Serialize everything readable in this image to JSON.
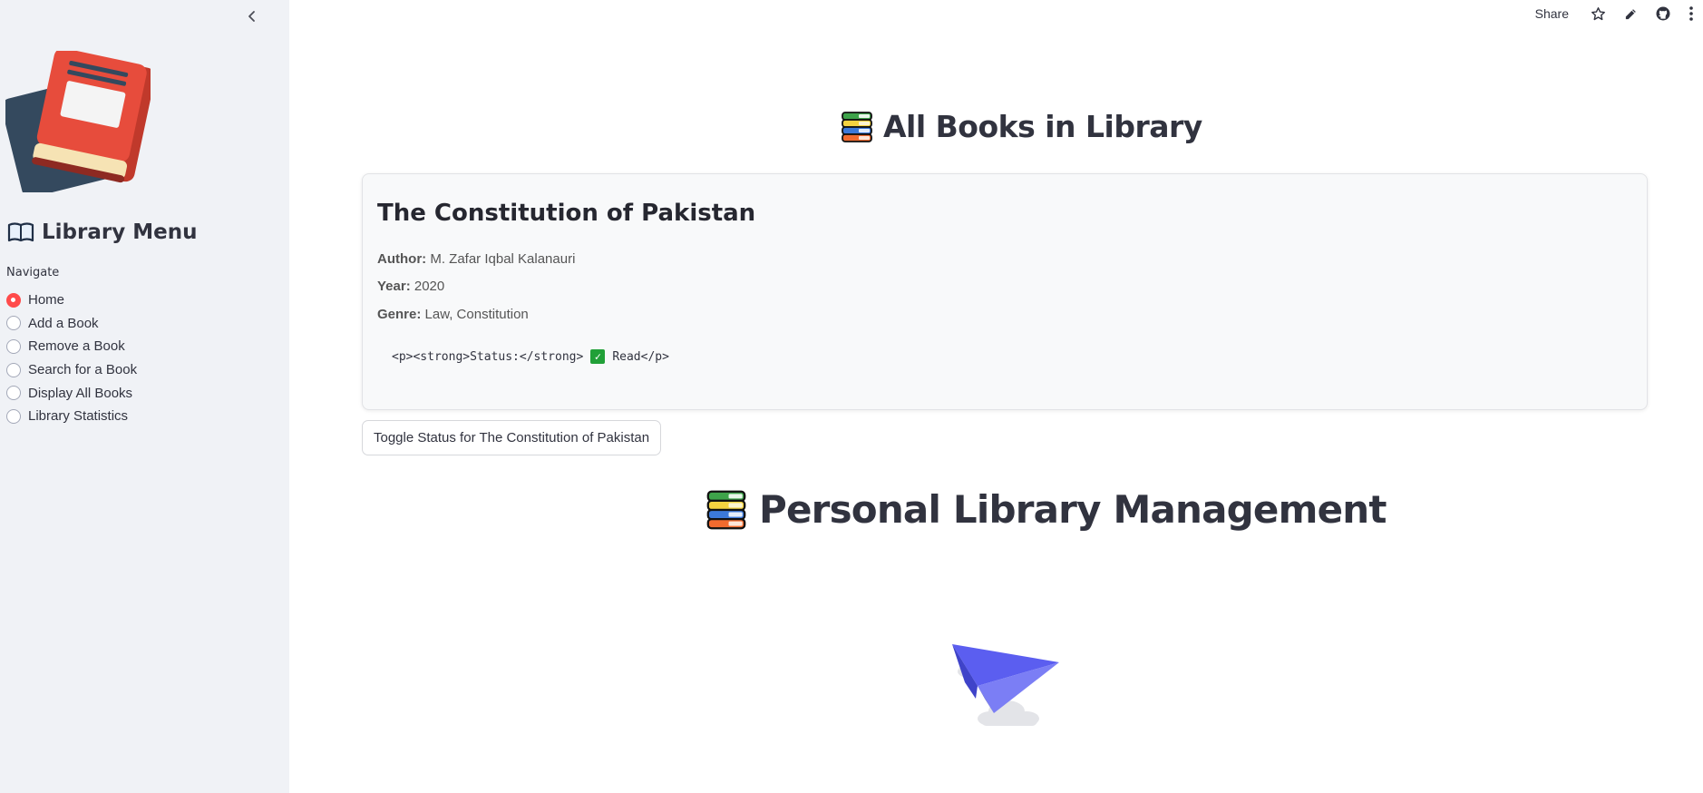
{
  "sidebar": {
    "menu_title": "Library Menu",
    "nav_label": "Navigate",
    "items": [
      {
        "label": "Home",
        "selected": true
      },
      {
        "label": "Add a Book",
        "selected": false
      },
      {
        "label": "Remove a Book",
        "selected": false
      },
      {
        "label": "Search for a Book",
        "selected": false
      },
      {
        "label": "Display All Books",
        "selected": false
      },
      {
        "label": "Library Statistics",
        "selected": false
      }
    ]
  },
  "toolbar": {
    "share_label": "Share",
    "icons": [
      "star-icon",
      "pencil-icon",
      "github-icon",
      "more-vertical-icon"
    ]
  },
  "main": {
    "heading": "All Books in Library",
    "book": {
      "title": "The Constitution of Pakistan",
      "author_label": "Author:",
      "author": "M. Zafar Iqbal Kalanauri",
      "year_label": "Year:",
      "year": "2020",
      "genre_label": "Genre:",
      "genre": "Law, Constitution",
      "status_prefix": "<p><strong>Status:</strong>",
      "status_suffix": "Read</p>"
    },
    "toggle_button": "Toggle Status for The Constitution of Pakistan",
    "big_heading": "Personal Library Management"
  },
  "colors": {
    "accent": "#ff4b4b",
    "sidebar_bg": "#f0f2f6",
    "card_bg": "#f8f9fa",
    "plane": "#5b5ef0"
  }
}
